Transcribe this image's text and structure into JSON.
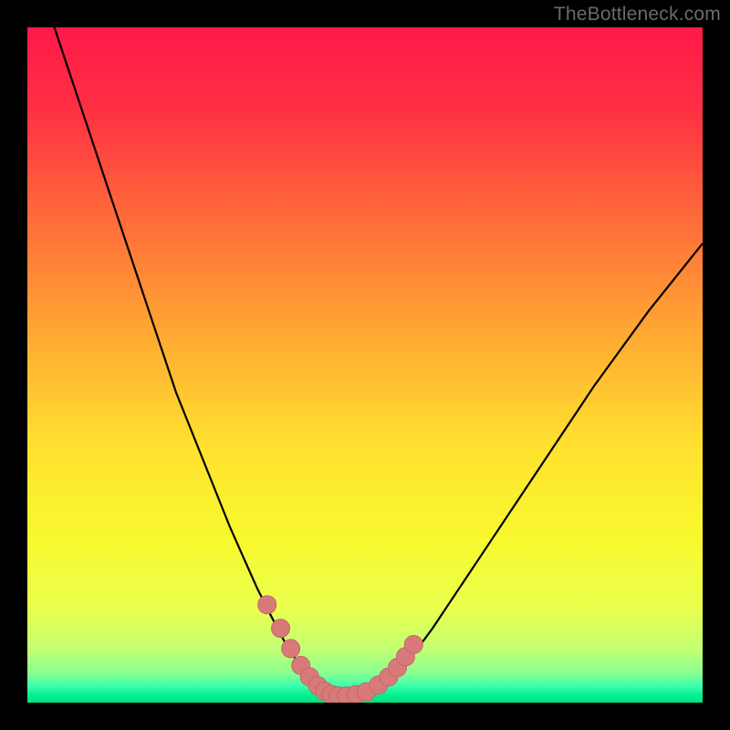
{
  "watermark": {
    "text": "TheBottleneck.com"
  },
  "colors": {
    "frame": "#000000",
    "curve": "#000000",
    "marker_fill": "#d97a7a",
    "marker_stroke": "#c76666",
    "gradient_stops": [
      {
        "offset": 0.0,
        "color": "#ff1a49"
      },
      {
        "offset": 0.12,
        "color": "#ff2f44"
      },
      {
        "offset": 0.28,
        "color": "#ff6a3a"
      },
      {
        "offset": 0.45,
        "color": "#ffa733"
      },
      {
        "offset": 0.62,
        "color": "#ffe12f"
      },
      {
        "offset": 0.76,
        "color": "#f8f92e"
      },
      {
        "offset": 0.86,
        "color": "#eaff4e"
      },
      {
        "offset": 0.92,
        "color": "#c3ff72"
      },
      {
        "offset": 0.955,
        "color": "#8cff8e"
      },
      {
        "offset": 0.975,
        "color": "#3dffad"
      },
      {
        "offset": 0.99,
        "color": "#00ee90"
      },
      {
        "offset": 1.0,
        "color": "#00e281"
      }
    ]
  },
  "chart_data": {
    "type": "line",
    "title": "",
    "xlabel": "",
    "ylabel": "",
    "xlim": [
      0,
      100
    ],
    "ylim": [
      0,
      100
    ],
    "grid": false,
    "legend": false,
    "series": [
      {
        "name": "bottleneck-curve",
        "x": [
          4,
          6,
          8,
          10,
          12,
          14,
          16,
          18,
          20,
          22,
          24,
          26,
          28,
          30,
          32,
          34,
          36,
          38,
          40,
          42,
          44,
          46,
          48,
          50,
          52,
          54,
          56,
          60,
          64,
          68,
          72,
          76,
          80,
          84,
          88,
          92,
          96,
          100
        ],
        "values": [
          100,
          94,
          88,
          82,
          76,
          70,
          64,
          58,
          52,
          46,
          41,
          36,
          31,
          26,
          21.5,
          17,
          13,
          9.2,
          6.0,
          3.6,
          1.8,
          0.8,
          0.6,
          0.9,
          1.8,
          3.4,
          5.6,
          11,
          17,
          23,
          29,
          35,
          41,
          47,
          52.5,
          58,
          63,
          68
        ]
      }
    ],
    "markers": {
      "name": "highlight-dots",
      "x": [
        35.5,
        37.5,
        39.0,
        40.5,
        41.8,
        43.0,
        44.0,
        45.0,
        46.0,
        47.3,
        48.7,
        50.2,
        52.0,
        53.5,
        54.8,
        56.0,
        57.2
      ],
      "y": [
        14.5,
        11.0,
        8.0,
        5.5,
        3.8,
        2.5,
        1.7,
        1.2,
        1.0,
        1.0,
        1.2,
        1.6,
        2.6,
        3.8,
        5.2,
        6.8,
        8.6
      ],
      "size_hint": "large"
    }
  }
}
